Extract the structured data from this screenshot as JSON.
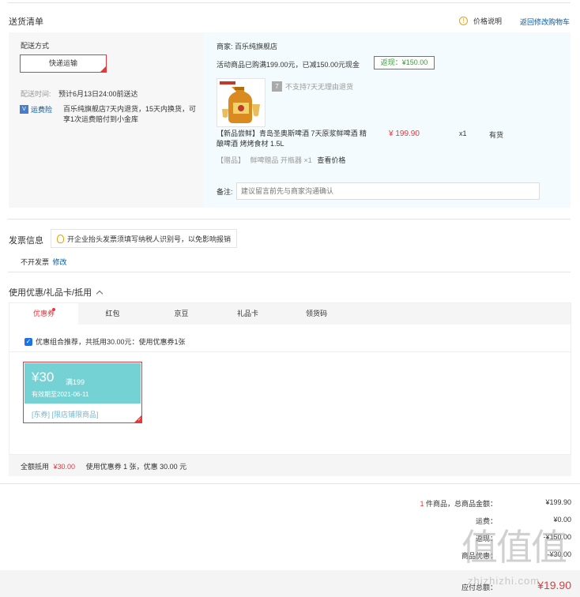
{
  "header": {
    "title": "送货清单",
    "price_note_label": "价格说明",
    "back_link": "返回修改购物车"
  },
  "delivery": {
    "method_label": "配送方式",
    "method_value": "快递运输",
    "time_label": "配送时间:",
    "time_value": "预计6月13日24:00前送达",
    "insurance_badge": "运费险",
    "insurance_text": "百乐纯旗舰店7天内退货，15天内换货，可享1次运费赔付到小金库"
  },
  "shop": {
    "merchant_label": "商家:",
    "merchant_name": "百乐纯旗舰店",
    "promo_text": "活动商品已购满199.00元，已减150.00元现金",
    "rebate_badge": "返现：¥150.00",
    "no_return_text": "不支持7天无理由退货",
    "product_title": "【新品尝鲜】青岛圣奥斯啤酒 7天原浆鲜啤酒 精酿啤酒 烤烤食材 1.5L",
    "product_price": "¥ 199.90",
    "product_qty": "x1",
    "product_stock": "有货",
    "gift_tag": "【赠品】",
    "gift_name": "鲜啤赠品 开瓶器 ×1",
    "gift_price_link": "查看价格",
    "remark_label": "备注:",
    "remark_placeholder": "建议留言前先与商家沟通确认"
  },
  "invoice": {
    "title": "发票信息",
    "tip": "开企业抬头发票须填写纳税人识别号，以免影响报销",
    "value": "不开发票",
    "edit_link": "修改"
  },
  "coupon": {
    "title": "使用优惠/礼品卡/抵用",
    "tabs": [
      "优惠券",
      "红包",
      "京豆",
      "礼品卡",
      "领货码"
    ],
    "recommend_text": "优惠组合推荐，共抵用30.00元：使用优惠券1张",
    "card_amount": "¥30",
    "card_condition": "满199",
    "card_expiry": "有效期至2021-06-11",
    "card_tag_type": "[东券]",
    "card_tag_scope": "[限店铺限商品]",
    "summary_label": "全额抵用",
    "summary_amount": "¥30.00",
    "summary_detail": "使用优惠券 1 张，优惠 30.00 元"
  },
  "totals": {
    "count": "1",
    "count_suffix": "件商品，总商品金额：",
    "goods_amount": "¥199.90",
    "freight_label": "运费：",
    "freight_amount": "¥0.00",
    "rebate_label": "返现：",
    "rebate_amount": "-¥150.00",
    "discount_label": "商品优惠：",
    "discount_amount": "-¥30.00",
    "payable_label": "应付总额：",
    "payable_amount": "¥19.90"
  },
  "watermark": {
    "main": "值值值",
    "sub": "zhizhizhi.com"
  },
  "colors": {
    "accent_red": "#e4393c",
    "link_blue": "#005aa0",
    "shop_panel": "#f3fbfe",
    "coupon_card": "#74d2d4",
    "rebate_green": "#3b9b3b"
  }
}
